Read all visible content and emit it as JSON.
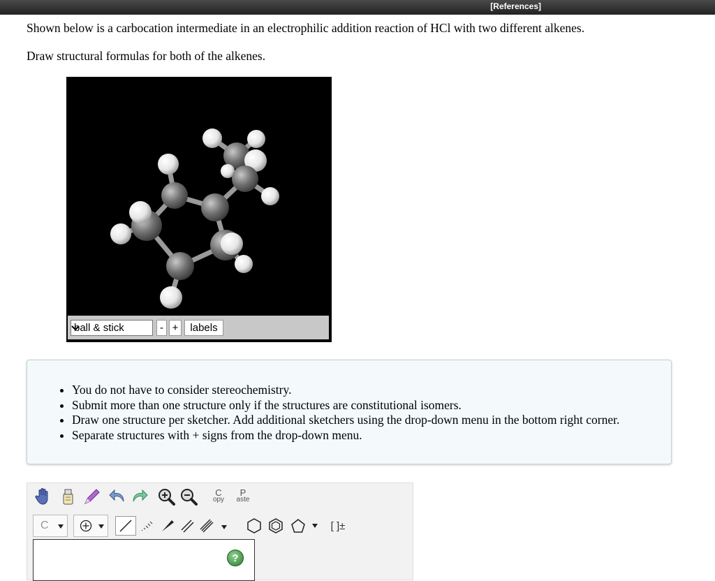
{
  "header": {
    "references_link": "[References]"
  },
  "question": {
    "line1": "Shown below is a carbocation intermediate in an electrophilic addition reaction of HCl with two different alkenes.",
    "line2": "Draw structural formulas for both of the alkenes."
  },
  "viewer": {
    "style_select": {
      "selected": "ball & stick"
    },
    "zoom_out_label": "-",
    "zoom_in_label": "+",
    "labels_button": "labels"
  },
  "notes": [
    "You do not have to consider stereochemistry.",
    "Submit more than one structure only if the structures are constitutional isomers.",
    "Draw one structure per sketcher. Add additional sketchers using the drop-down menu in the bottom right corner.",
    "Separate structures with + signs from the drop-down menu."
  ],
  "sketcher": {
    "copy_top": "C",
    "copy_bottom": "opy",
    "paste_top": "P",
    "paste_bottom": "aste",
    "atom_label": "C",
    "charge_label": "[ ]±",
    "help_label": "?"
  }
}
